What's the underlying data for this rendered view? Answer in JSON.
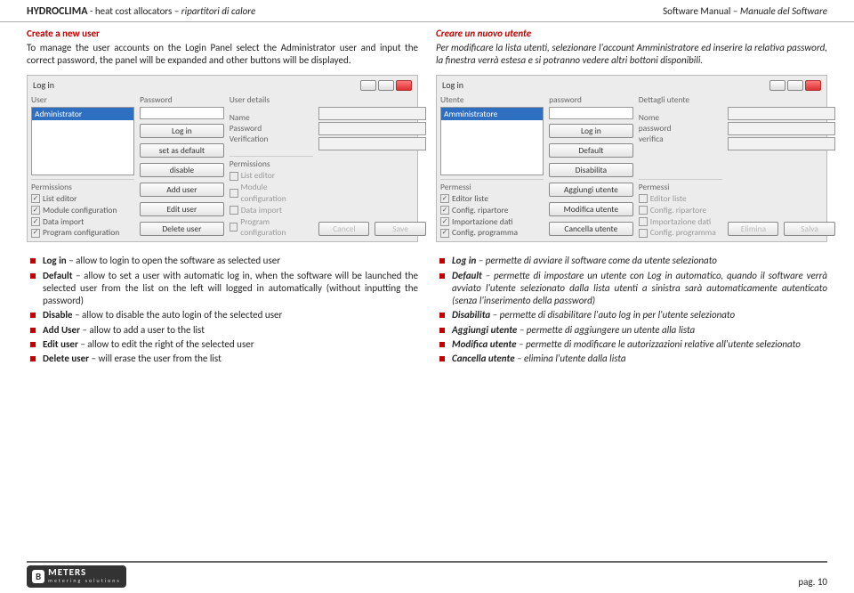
{
  "header": {
    "logo": "HYDROCLIMA",
    "tagline_en": "- heat cost allocators – ",
    "tagline_it": "ripartitori di calore",
    "manual_en": "Software Manual – ",
    "manual_it": "Manuale del Software"
  },
  "intro": {
    "en": {
      "title": "Create a new user",
      "body": "To manage the user accounts on the Login Panel select the Administrator user and input the correct password, the panel will be expanded and other buttons will be displayed."
    },
    "it": {
      "title": "Creare un nuovo utente",
      "body": "Per modificare la lista utenti, selezionare l'account Amministratore ed inserire la relativa password, la finestra verrà estesa e si potranno vedere altri bottoni disponibili."
    }
  },
  "shot_en": {
    "window_title": "Log in",
    "user_label": "User",
    "user_item": "Administrator",
    "password_label": "Password",
    "btn_login": "Log in",
    "btn_default": "set as default",
    "btn_disable": "disable",
    "btn_add": "Add user",
    "btn_edit": "Edit user",
    "btn_delete": "Delete user",
    "permissions_label": "Permissions",
    "perm1": "List editor",
    "perm2": "Module configuration",
    "perm3": "Data import",
    "perm4": "Program configuration",
    "details_label": "User details",
    "name_label": "Name",
    "pwd_label": "Password",
    "verif_label": "Verification",
    "perm_ro1": "List editor",
    "perm_ro2": "Module configuration",
    "perm_ro3": "Data import",
    "perm_ro4": "Program configuration",
    "btn_cancel": "Cancel",
    "btn_save": "Save"
  },
  "shot_it": {
    "window_title": "Log in",
    "user_label": "Utente",
    "user_item": "Amministratore",
    "password_label": "password",
    "btn_login": "Log in",
    "btn_default": "Default",
    "btn_disable": "Disabilita",
    "btn_add": "Aggiungi utente",
    "btn_edit": "Modifica utente",
    "btn_delete": "Cancella utente",
    "permissions_label": "Permessi",
    "perm1": "Editor liste",
    "perm2": "Config. ripartore",
    "perm3": "Importazione dati",
    "perm4": "Config. programma",
    "details_label": "Dettagli utente",
    "name_label": "Nome",
    "pwd_label": "password",
    "verif_label": "verifica",
    "perm_ro1": "Editor liste",
    "perm_ro2": "Config. ripartore",
    "perm_ro3": "Importazione dati",
    "perm_ro4": "Config. programma",
    "btn_cancel": "Elimina",
    "btn_save": "Salva"
  },
  "bullets": {
    "en": [
      {
        "b": "Log in",
        "t": " – allow to login to open the software as selected user"
      },
      {
        "b": "Default",
        "t": " – allow to set a user with automatic log in, when the software will be launched the selected user from the list on the left will logged in automatically (without inputting the password)"
      },
      {
        "b": "Disable",
        "t": " – allow to disable the auto login of the selected user"
      },
      {
        "b": "Add User",
        "t": " – allow to add a user to the list"
      },
      {
        "b": "Edit user",
        "t": " – allow to edit the right of the selected user"
      },
      {
        "b": "Delete user",
        "t": " – will erase the user from the list"
      }
    ],
    "it": [
      {
        "b": "Log in",
        "t": " – permette di avviare il software come da utente selezionato"
      },
      {
        "b": "Default",
        "t": " – permette di impostare un utente con Log in automatico, quando il software verrà avviato l'utente selezionato dalla lista utenti a sinistra sarà automaticamente autenticato (senza l'inserimento della password)"
      },
      {
        "b": "Disabilita",
        "t": " – permette di disabilitare l'auto log in per l'utente selezionato"
      },
      {
        "b": "Aggiungi utente",
        "t": " – permette di aggiungere un utente alla lista"
      },
      {
        "b": "Modifica utente",
        "t": "  – permette di modificare le autorizzazioni relative all'utente selezionato"
      },
      {
        "b": "Cancella utente",
        "t": "  – elimina l'utente dalla lista"
      }
    ]
  },
  "footer": {
    "logo_b": "B",
    "logo_big": "METERS",
    "logo_small": "metering solutions",
    "page": "pag. 10"
  }
}
